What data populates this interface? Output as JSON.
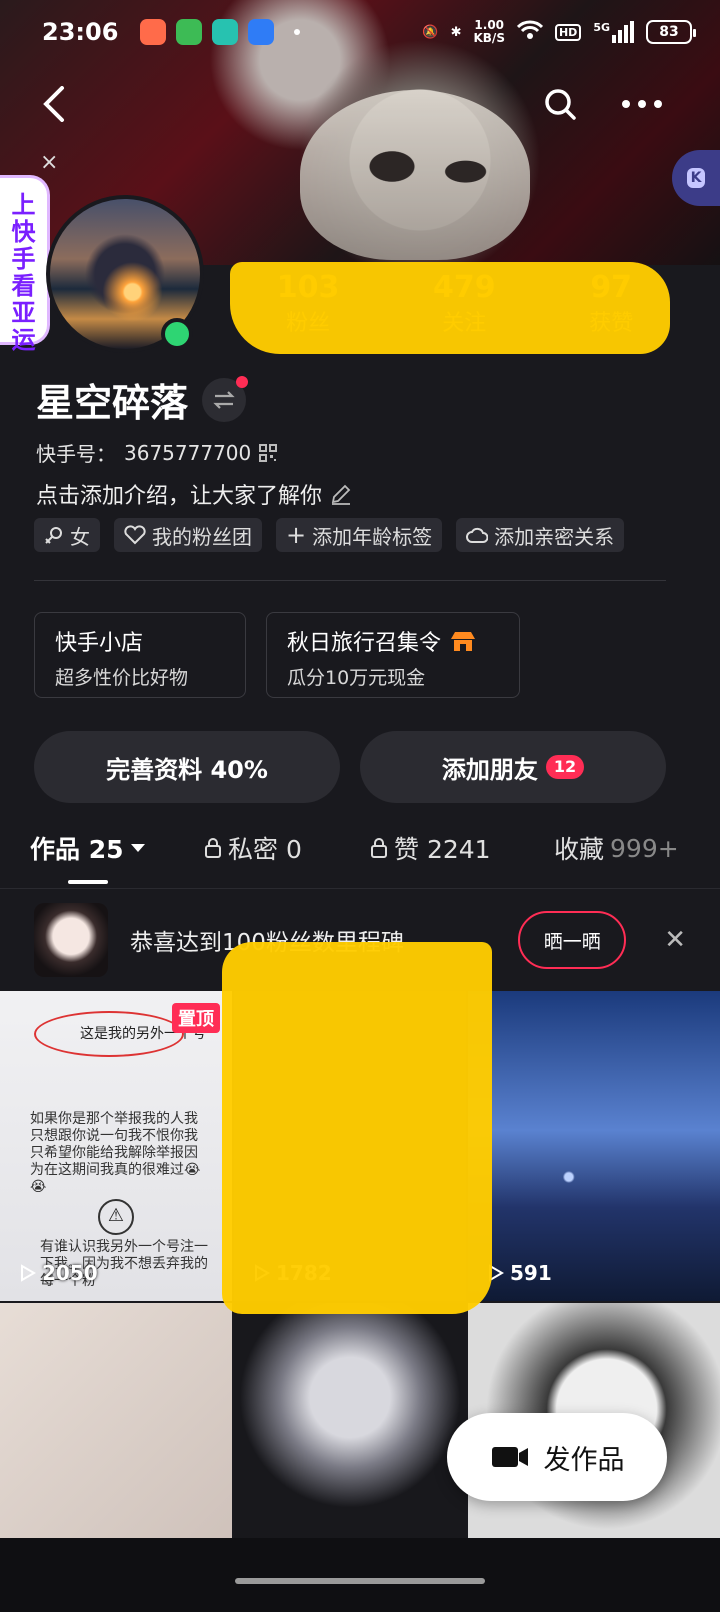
{
  "status_bar": {
    "time": "23:06",
    "net_speed_value": "1.00",
    "net_speed_unit": "KB/S",
    "hd_label": "HD",
    "signal_label": "5G",
    "battery": "83"
  },
  "side_tab": {
    "text": "上快手 看亚运"
  },
  "profile": {
    "stats": [
      {
        "value": "103",
        "label": "粉丝"
      },
      {
        "value": "479",
        "label": "关注"
      },
      {
        "value": "97",
        "label": "获赞"
      }
    ],
    "name": "星空碎落",
    "kuaishou_id_label": "快手号：",
    "kuaishou_id": "3675777700",
    "intro": "点击添加介绍，让大家了解你",
    "tags": [
      {
        "label": "女",
        "icon": "female-icon"
      },
      {
        "label": "我的粉丝团",
        "icon": "heart-icon"
      },
      {
        "label": "添加年龄标签",
        "icon": "plus-icon"
      },
      {
        "label": "添加亲密关系",
        "icon": "cloud-icon"
      }
    ]
  },
  "cards": [
    {
      "title": "快手小店",
      "subtitle": "超多性价比好物"
    },
    {
      "title": "秋日旅行召集令",
      "subtitle": "瓜分10万元现金"
    }
  ],
  "buttons": {
    "complete_profile": "完善资料 40%",
    "add_friend": "添加朋友",
    "add_friend_badge": "12"
  },
  "tabs": [
    {
      "label": "作品 25"
    },
    {
      "label": "私密 0"
    },
    {
      "label": "赞 2241"
    },
    {
      "label": "收藏",
      "count": "999+"
    }
  ],
  "milestone": {
    "text": "恭喜达到100粉丝数里程碑",
    "button": "晒一晒"
  },
  "grid": {
    "pinned_label": "置顶",
    "items": [
      {
        "plays": "2050",
        "caption_top": "这是我的另外一个号",
        "caption_body": "如果你是那个举报我的人我只想跟你说一句我不恨你我只希望你能给我解除举报因为在这期间我真的很难过😭😭",
        "caption_bottom": "有谁认识我另外一个号注一下我。因为我不想丢弃我的每一个粉"
      },
      {
        "plays": "1782"
      },
      {
        "plays": "591"
      }
    ]
  },
  "fab": {
    "label": "发作品"
  },
  "colors": {
    "accent": "#ff2d55",
    "online": "#2ed573",
    "background": "#19191e",
    "redaction": "#ffcc00"
  }
}
